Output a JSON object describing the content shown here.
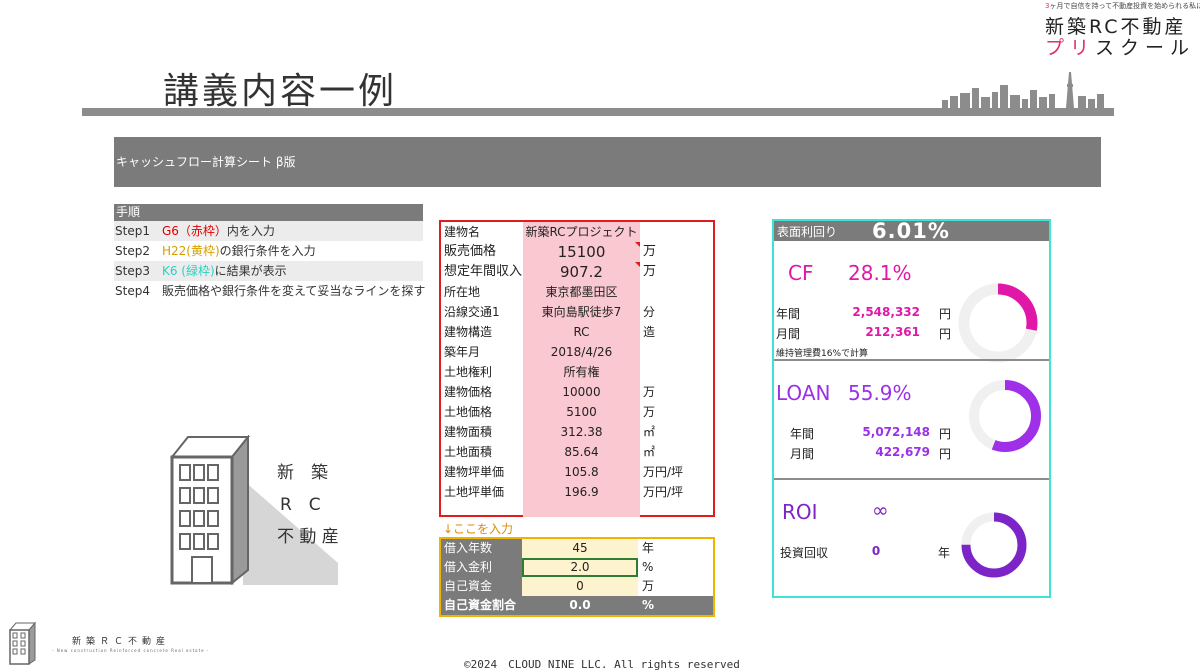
{
  "header": {
    "tagline_highlight": "3",
    "tagline_rest": "ヶ月で自信を持って不動産投資を始められる私になる",
    "brand_line1": "新築RC不動産",
    "brand_line2_highlight": "プリ",
    "brand_line2_rest": "スクール",
    "page_title": "講義内容一例"
  },
  "sheet": {
    "banner_title": "キャッシュフロー計算シート β版"
  },
  "steps": {
    "header": "手順",
    "items": [
      {
        "step": "Step1",
        "key": "G6（赤枠）",
        "text": "内を入力"
      },
      {
        "step": "Step2",
        "key": "H22(黄枠)",
        "text": "の銀行条件を入力"
      },
      {
        "step": "Step3",
        "key": "K6 (緑枠)",
        "text": "に結果が表示"
      },
      {
        "step": "Step4",
        "key": "",
        "text": "販売価格や銀行条件を変えて妥当なラインを探す"
      }
    ]
  },
  "building_text": {
    "line1": "新　築",
    "line2": "R　C",
    "line3": "不 動 産"
  },
  "property": {
    "rows": [
      {
        "label": "建物名",
        "value": "新築RCプロジェクト",
        "unit": ""
      },
      {
        "label": "販売価格",
        "value": "15100",
        "unit": "万"
      },
      {
        "label": "想定年間収入",
        "value": "907.2",
        "unit": "万"
      },
      {
        "label": "所在地",
        "value": "東京都墨田区",
        "unit": ""
      },
      {
        "label": "沿線交通1",
        "value": "東向島駅徒歩7",
        "unit": "分"
      },
      {
        "label": "建物構造",
        "value": "RC",
        "unit": "造"
      },
      {
        "label": "築年月",
        "value": "2018/4/26",
        "unit": ""
      },
      {
        "label": "土地権利",
        "value": "所有権",
        "unit": ""
      },
      {
        "label": "建物価格",
        "value": "10000",
        "unit": "万"
      },
      {
        "label": "土地価格",
        "value": "5100",
        "unit": "万"
      },
      {
        "label": "建物面積",
        "value": "312.38",
        "unit": "㎡"
      },
      {
        "label": "土地面積",
        "value": "85.64",
        "unit": "㎡"
      },
      {
        "label": "建物坪単価",
        "value": "105.8",
        "unit": "万円/坪"
      },
      {
        "label": "土地坪単価",
        "value": "196.9",
        "unit": "万円/坪"
      }
    ],
    "input_hint": "↓ここを入力"
  },
  "loan": {
    "rows": [
      {
        "label": "借入年数",
        "value": "45",
        "unit": "年"
      },
      {
        "label": "借入金利",
        "value": "2.0",
        "unit": "%"
      },
      {
        "label": "自己資金",
        "value": "0",
        "unit": "万"
      },
      {
        "label": "自己資金割合",
        "value": "0.0",
        "unit": "%"
      }
    ]
  },
  "results": {
    "yield_label": "表面利回り",
    "yield_value": "6.01%",
    "cf": {
      "label": "CF",
      "percent": "28.1%",
      "ratio": 0.281,
      "annual_label": "年間",
      "annual_value": "2,548,332",
      "monthly_label": "月間",
      "monthly_value": "212,361",
      "unit": "円",
      "note": "維持管理費16%で計算",
      "color": "#e018a8"
    },
    "loan": {
      "label": "LOAN",
      "percent": "55.9%",
      "ratio": 0.559,
      "annual_label": "年間",
      "annual_value": "5,072,148",
      "monthly_label": "月間",
      "monthly_value": "422,679",
      "unit": "円",
      "color": "#a030e8"
    },
    "roi": {
      "label": "ROI",
      "value": "∞",
      "payback_label": "投資回収",
      "payback_value": "0",
      "payback_unit": "年",
      "ratio": 0.75,
      "color": "#7d24c8"
    }
  },
  "footer": {
    "brand": "新築ＲＣ不動産",
    "sub": "- New construction Reinforced concrete Real estate -",
    "copyright": "©2024　CLOUD NINE LLC. All rights reserved"
  }
}
